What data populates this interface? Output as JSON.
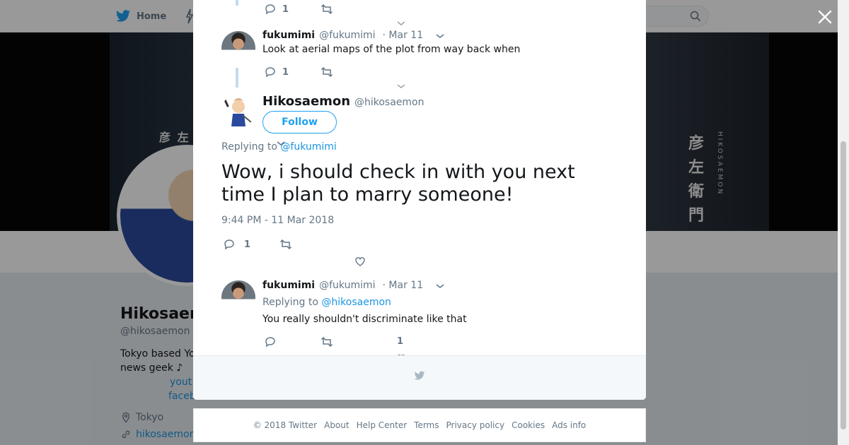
{
  "topbar": {
    "home_label": "Home"
  },
  "profile": {
    "name": "Hikosaer",
    "handle": "@hikosaemon",
    "bio": "Tokyo based Yo news geek ♪",
    "links": [
      "yout",
      "faceb"
    ],
    "location": "Tokyo",
    "url": "hikosaemon"
  },
  "banner": {
    "kanji_left": "彦 左",
    "kanji_right": "彦左衛門",
    "latin_right": "HIKOSAEMON"
  },
  "modal": {
    "tweet_top": {
      "reply_count": "1"
    },
    "tweet_fukumimi_1": {
      "name": "fukumimi",
      "handle": "@fukumimi",
      "date": "· Mar 11",
      "text": "Look at aerial maps of the plot from way back when",
      "reply_count": "1"
    },
    "main_tweet": {
      "name": "Hikosaemon",
      "handle": "@hikosaemon",
      "follow_label": "Follow",
      "replying_prefix": "Replying to",
      "replying_to": "@fukumimi",
      "text": "Wow, i should check in with you next time I plan to marry someone!",
      "timestamp": "9:44 PM - 11 Mar 2018",
      "reply_count": "1"
    },
    "tweet_fukumimi_2": {
      "name": "fukumimi",
      "handle": "@fukumimi",
      "date": "· Mar 11",
      "replying_prefix": "Replying to",
      "replying_to": "@hikosaemon",
      "text": "You really shouldn't discriminate like that",
      "like_count": "1"
    }
  },
  "footer": {
    "links": [
      "© 2018 Twitter",
      "About",
      "Help Center",
      "Terms",
      "Privacy policy",
      "Cookies",
      "Ads info"
    ]
  },
  "colors": {
    "accent": "#1da1f2",
    "link": "#1b95e0",
    "muted": "#657786",
    "thread": "#c4dbee"
  }
}
